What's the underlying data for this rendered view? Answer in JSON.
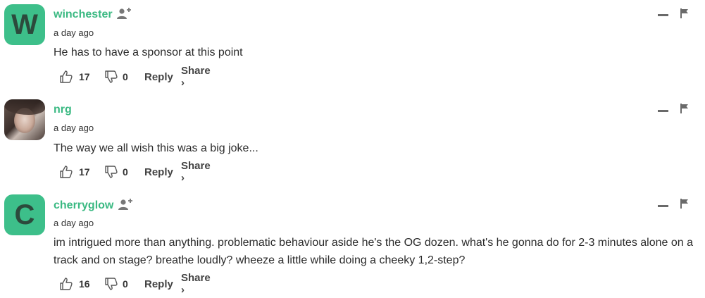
{
  "colors": {
    "accent": "#3ab982",
    "avatar_bg": "#3dbf8a",
    "text": "#2b2b2b"
  },
  "comments": [
    {
      "username": "winchester",
      "avatar_letter": "W",
      "avatar_type": "letter",
      "show_follow_icon": true,
      "timestamp": "a day ago",
      "text": "He has to have a sponsor at this point",
      "likes": "17",
      "dislikes": "0",
      "reply_label": "Reply",
      "share_label": "Share ›"
    },
    {
      "username": "nrg",
      "avatar_type": "photo",
      "show_follow_icon": false,
      "timestamp": "a day ago",
      "text": "The way we all wish this was a big joke...",
      "likes": "17",
      "dislikes": "0",
      "reply_label": "Reply",
      "share_label": "Share ›"
    },
    {
      "username": "cherryglow",
      "avatar_letter": "C",
      "avatar_type": "letter",
      "show_follow_icon": true,
      "timestamp": "a day ago",
      "text": "im intrigued more than anything. problematic behaviour aside he's the OG dozen. what's he gonna do for 2-3 minutes alone on a track and on stage? breathe loudly? wheeze a little while doing a cheeky 1,2-step?",
      "likes": "16",
      "dislikes": "0",
      "reply_label": "Reply",
      "share_label": "Share ›"
    }
  ]
}
